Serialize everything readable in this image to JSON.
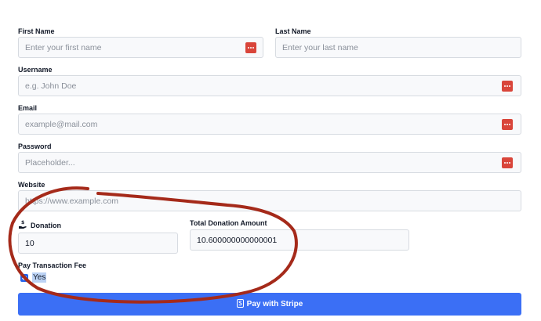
{
  "form": {
    "first_name": {
      "label": "First Name",
      "placeholder": "Enter your first name"
    },
    "last_name": {
      "label": "Last Name",
      "placeholder": "Enter your last name"
    },
    "username": {
      "label": "Username",
      "placeholder": "e.g. John Doe"
    },
    "email": {
      "label": "Email",
      "placeholder": "example@mail.com"
    },
    "password": {
      "label": "Password",
      "placeholder": "Placeholder..."
    },
    "website": {
      "label": "Website",
      "placeholder": "https://www.example.com"
    },
    "donation": {
      "label": "Donation",
      "value": "10",
      "icon": "donation-hand-icon"
    },
    "total_donation": {
      "label": "Total Donation Amount",
      "value": "10.600000000000001"
    },
    "transaction_fee": {
      "label": "Pay Transaction Fee",
      "option_label": "Yes",
      "checked": true
    },
    "submit": {
      "label": "Pay with Stripe",
      "icon": "stripe-icon"
    }
  },
  "colors": {
    "accent": "#3b6ff5",
    "password_manager_icon": "#d9453a",
    "annotation": "#a52a1a"
  }
}
